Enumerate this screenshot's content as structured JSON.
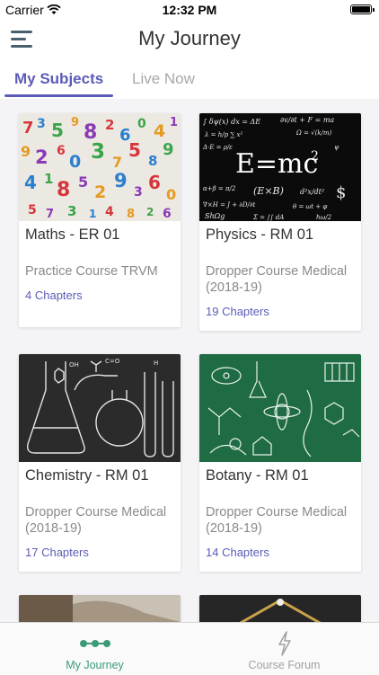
{
  "status_bar": {
    "carrier": "Carrier",
    "time": "12:32 PM"
  },
  "header": {
    "title": "My Journey"
  },
  "tabs": [
    {
      "label": "My Subjects",
      "active": true
    },
    {
      "label": "Live Now",
      "active": false
    }
  ],
  "subjects": [
    {
      "name": "Maths - ER 01",
      "course": "Practice Course TRVM",
      "chapters": "4 Chapters",
      "image": "colorful-numbers"
    },
    {
      "name": "Physics - RM 01",
      "course": "Dropper Course Medical (2018-19)",
      "chapters": "19 Chapters",
      "image": "blackboard-equations"
    },
    {
      "name": "Chemistry - RM 01",
      "course": "Dropper Course Medical (2018-19)",
      "chapters": "17 Chapters",
      "image": "lab-glassware-sketch"
    },
    {
      "name": "Botany - RM 01",
      "course": "Dropper Course Medical (2018-19)",
      "chapters": "14 Chapters",
      "image": "green-chalkboard-biology"
    }
  ],
  "bottom_nav": [
    {
      "label": "My Journey",
      "icon": "journey-dots-icon",
      "active": true
    },
    {
      "label": "Course Forum",
      "icon": "lightning-icon",
      "active": false
    }
  ],
  "colors": {
    "accent": "#5c5cb8",
    "active_tab": "#3a9c76",
    "inactive": "#a0a0a0"
  }
}
